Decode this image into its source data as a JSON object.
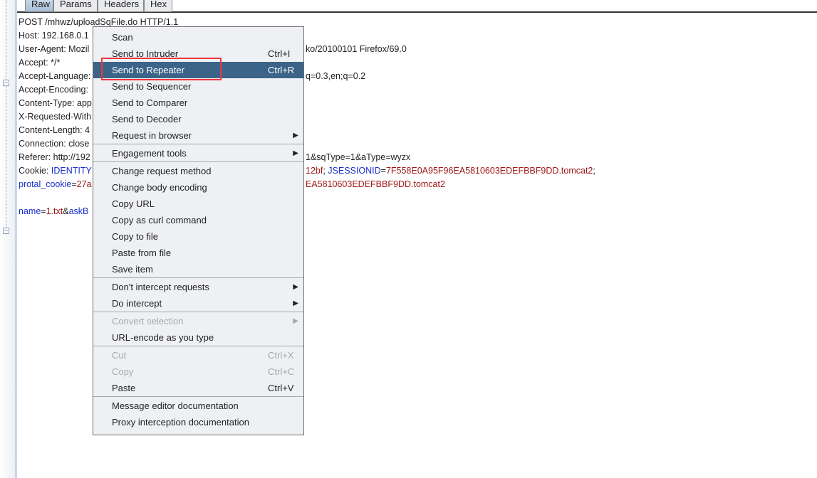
{
  "tabs": [
    "Raw",
    "Params",
    "Headers",
    "Hex"
  ],
  "selected_tab": "Raw",
  "request_lines": [
    {
      "left": [
        {
          "t": "POST /mhwz/uploadSqFile.do HTTP/1.1",
          "c": ""
        }
      ],
      "right": []
    },
    {
      "left": [
        {
          "t": "Host: 192.168.0.1",
          "c": ""
        }
      ],
      "right": []
    },
    {
      "left": [
        {
          "t": "User-Agent: Mozil",
          "c": ""
        }
      ],
      "right": [
        {
          "t": "ko/20100101 Firefox/69.0",
          "c": ""
        }
      ]
    },
    {
      "left": [
        {
          "t": "Accept: */*",
          "c": ""
        }
      ],
      "right": []
    },
    {
      "left": [
        {
          "t": "Accept-Language:",
          "c": ""
        }
      ],
      "right": [
        {
          "t": "q=0.3,en;q=0.2",
          "c": ""
        }
      ]
    },
    {
      "left": [
        {
          "t": "Accept-Encoding:",
          "c": ""
        }
      ],
      "right": []
    },
    {
      "left": [
        {
          "t": "Content-Type: app",
          "c": ""
        }
      ],
      "right": []
    },
    {
      "left": [
        {
          "t": "X-Requested-With",
          "c": ""
        }
      ],
      "right": []
    },
    {
      "left": [
        {
          "t": "Content-Length: 4",
          "c": ""
        }
      ],
      "right": []
    },
    {
      "left": [
        {
          "t": "Connection: close",
          "c": ""
        }
      ],
      "right": []
    },
    {
      "left": [
        {
          "t": "Referer: http://192",
          "c": ""
        }
      ],
      "right": [
        {
          "t": "1&sqType=1&aType=wyzx",
          "c": ""
        }
      ]
    },
    {
      "left": [
        {
          "t": "Cookie: ",
          "c": ""
        },
        {
          "t": "IDENTITY",
          "c": "k"
        }
      ],
      "right": [
        {
          "t": "12bf",
          "c": "v"
        },
        {
          "t": "; ",
          "c": ""
        },
        {
          "t": "JSESSIONID",
          "c": "k"
        },
        {
          "t": "=",
          "c": ""
        },
        {
          "t": "7F558E0A95F96EA5810603EDEFBBF9DD.tomcat2",
          "c": "v"
        },
        {
          "t": ";",
          "c": ""
        }
      ]
    },
    {
      "left": [
        {
          "t": "protal_cookie",
          "c": "k"
        },
        {
          "t": "=",
          "c": ""
        },
        {
          "t": "27a",
          "c": "v"
        }
      ],
      "right": [
        {
          "t": "EA5810603EDEFBBF9DD.tomcat2",
          "c": "v"
        }
      ]
    },
    {
      "left": [],
      "right": []
    },
    {
      "left": [
        {
          "t": "name",
          "c": "k"
        },
        {
          "t": "=",
          "c": ""
        },
        {
          "t": "1.txt",
          "c": "v"
        },
        {
          "t": "&",
          "c": ""
        },
        {
          "t": "askB",
          "c": "k"
        }
      ],
      "right": []
    }
  ],
  "context_menu": {
    "groups": [
      [
        {
          "label": "Scan"
        },
        {
          "label": "Send to Intruder",
          "shortcut": "Ctrl+I"
        },
        {
          "label": "Send to Repeater",
          "shortcut": "Ctrl+R",
          "highlighted": true
        },
        {
          "label": "Send to Sequencer"
        },
        {
          "label": "Send to Comparer"
        },
        {
          "label": "Send to Decoder"
        },
        {
          "label": "Request in browser",
          "submenu": true
        }
      ],
      [
        {
          "label": "Engagement tools",
          "submenu": true
        }
      ],
      [
        {
          "label": "Change request method"
        },
        {
          "label": "Change body encoding"
        },
        {
          "label": "Copy URL"
        },
        {
          "label": "Copy as curl command"
        },
        {
          "label": "Copy to file"
        },
        {
          "label": "Paste from file"
        },
        {
          "label": "Save item"
        }
      ],
      [
        {
          "label": "Don't intercept requests",
          "submenu": true
        },
        {
          "label": "Do intercept",
          "submenu": true
        }
      ],
      [
        {
          "label": "Convert selection",
          "submenu": true,
          "disabled": true
        },
        {
          "label": "URL-encode as you type"
        }
      ],
      [
        {
          "label": "Cut",
          "shortcut": "Ctrl+X",
          "disabled": true
        },
        {
          "label": "Copy",
          "shortcut": "Ctrl+C",
          "disabled": true
        },
        {
          "label": "Paste",
          "shortcut": "Ctrl+V"
        }
      ],
      [
        {
          "label": "Message editor documentation"
        },
        {
          "label": "Proxy interception documentation"
        }
      ]
    ]
  },
  "colors": {
    "highlight": "#3b6488",
    "annotation_box": "#f0363c",
    "key": "#1a2ecc",
    "value": "#a01818"
  }
}
